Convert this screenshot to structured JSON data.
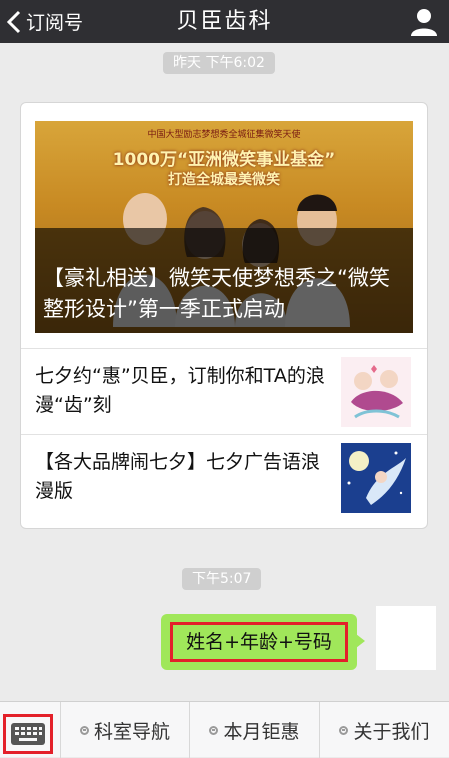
{
  "header": {
    "back_label": "订阅号",
    "title": "贝臣齿科"
  },
  "messages": {
    "timestamp_1": "昨天 下午6:02",
    "timestamp_2": "下午5:07",
    "news": {
      "hero": {
        "banner_top": "中国大型励志梦想秀全城征集微笑天使",
        "banner_slogan": "1000万“亚洲微笑事业基金”",
        "banner_slogan2": "打造全城最美微笑",
        "caption": "【豪礼相送】微笑天使梦想秀之“微笑整形设计”第一季正式启动"
      },
      "items": [
        {
          "title": "七夕约“惠”贝臣，订制你和TA的浪漫“齿”刻"
        },
        {
          "title": "【各大品牌闹七夕】七夕广告语浪漫版"
        }
      ]
    },
    "outgoing_text": "姓名+年龄+号码"
  },
  "bottom_menu": {
    "items": [
      {
        "label": "科室导航"
      },
      {
        "label": "本月钜惠"
      },
      {
        "label": "关于我们"
      }
    ]
  },
  "colors": {
    "topbar": "#2f2f33",
    "bubble": "#a0e75a",
    "highlight": "#e3202a"
  }
}
